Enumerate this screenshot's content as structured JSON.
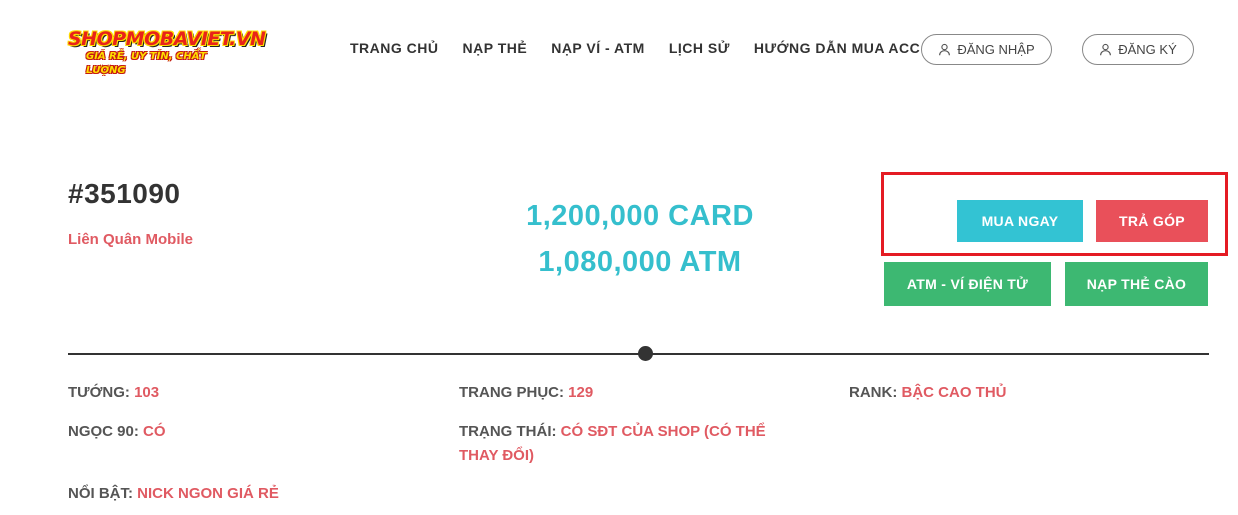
{
  "logo": {
    "brand": "SHOPMOBAVIET.VN",
    "slogan": "GIÁ RẺ, UY TÍN, CHẤT LƯỢNG"
  },
  "nav": {
    "items": [
      {
        "label": "TRANG CHỦ"
      },
      {
        "label": "NẠP THẺ"
      },
      {
        "label": "NẠP VÍ - ATM"
      },
      {
        "label": "LỊCH SỬ"
      },
      {
        "label": "HƯỚNG DẪN MUA ACC"
      }
    ],
    "login_label": "ĐĂNG NHẬP",
    "register_label": "ĐĂNG KÝ"
  },
  "account": {
    "id": "#351090",
    "game": "Liên Quân Mobile",
    "price_card": "1,200,000 CARD",
    "price_atm": "1,080,000 ATM"
  },
  "actions": {
    "buy_now": "MUA NGAY",
    "installment": "TRẢ GÓP",
    "atm_wallet": "ATM - VÍ ĐIỆN TỬ",
    "card_topup": "NẠP THẺ CÀO"
  },
  "attributes": {
    "heroes_label": "TƯỚNG:",
    "heroes_value": "103",
    "skins_label": "TRANG PHỤC:",
    "skins_value": "129",
    "rank_label": "RANK:",
    "rank_value": "BẬC CAO THỦ",
    "gems_label": "NGỌC 90:",
    "gems_value": "CÓ",
    "status_label": "TRẠNG THÁI:",
    "status_value": "CÓ SĐT CỦA SHOP (CÓ THỂ THAY ĐỔI)",
    "highlight_label": "NỔI BẬT:",
    "highlight_value": "NICK NGON GIÁ RẺ"
  },
  "colors": {
    "price": "#35bfcd",
    "accent_red": "#e05a62",
    "buy_button": "#33c3d3",
    "installment_button": "#e9505a",
    "green_button": "#3db872",
    "highlight_border": "#e41b23"
  },
  "icons": {
    "login": "user-icon",
    "register": "user-icon"
  }
}
